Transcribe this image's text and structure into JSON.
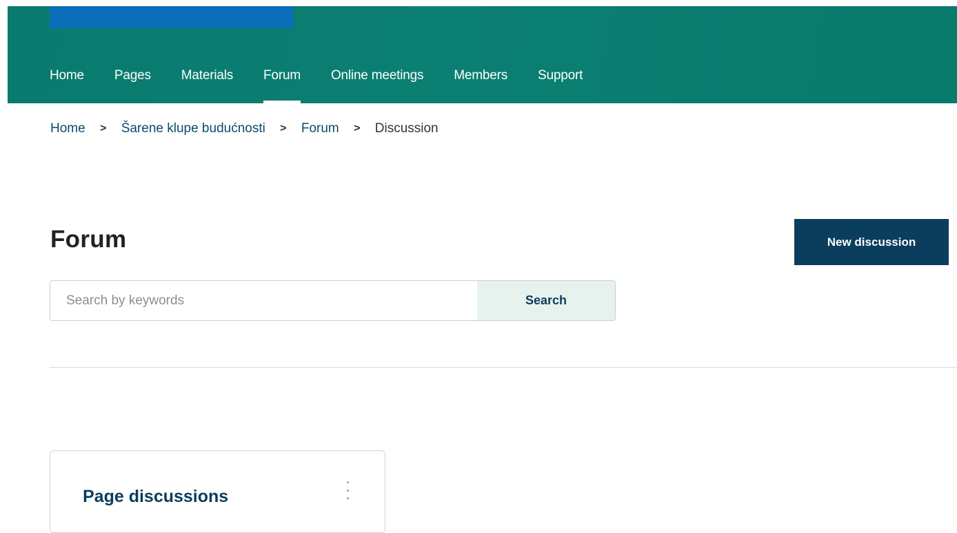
{
  "nav": {
    "items": [
      {
        "label": "Home",
        "active": false
      },
      {
        "label": "Pages",
        "active": false
      },
      {
        "label": "Materials",
        "active": false
      },
      {
        "label": "Forum",
        "active": true
      },
      {
        "label": "Online meetings",
        "active": false
      },
      {
        "label": "Members",
        "active": false
      },
      {
        "label": "Support",
        "active": false
      }
    ]
  },
  "breadcrumb": {
    "items": [
      "Home",
      "Šarene klupe budućnosti",
      "Forum",
      "Discussion"
    ],
    "separator_icon": "chevron-right-icon"
  },
  "main": {
    "title": "Forum",
    "new_discussion_label": "New discussion",
    "search": {
      "placeholder": "Search by keywords",
      "value": "",
      "button_label": "Search"
    },
    "cards": [
      {
        "title": "Page discussions",
        "menu_icon": "kebab-menu-icon"
      }
    ]
  },
  "colors": {
    "header_bg": "#0b7f72",
    "logo_band": "#0a6fb8",
    "primary_button": "#0b3d5c",
    "search_button_bg": "#e7f2ef",
    "link": "#0b4a6e"
  }
}
